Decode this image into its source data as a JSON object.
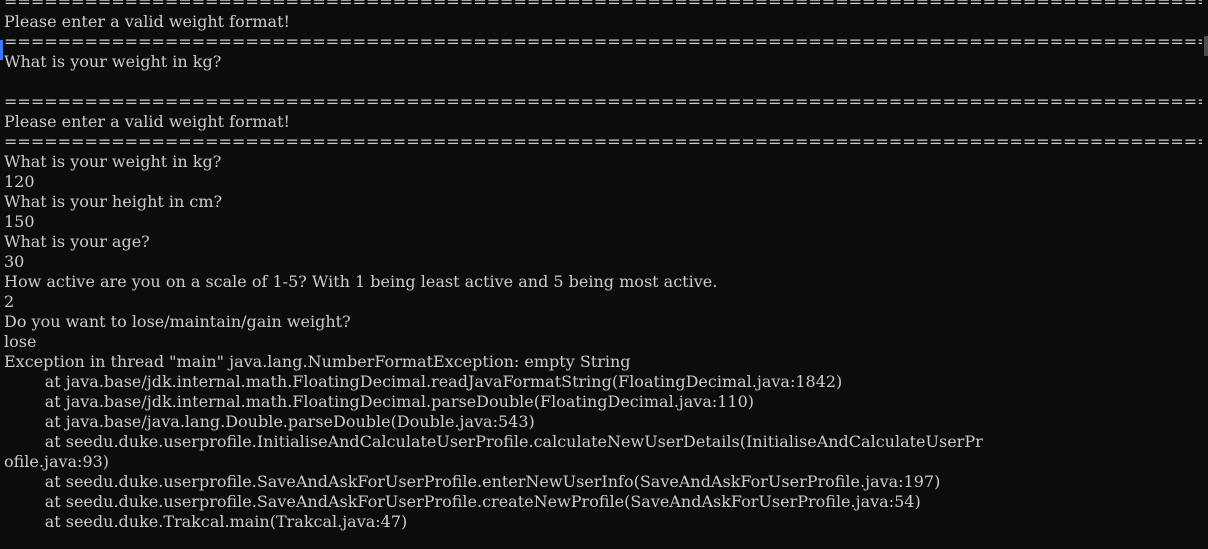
{
  "terminal": {
    "lines": [
      "==========================================================================================================",
      "Please enter a valid weight format!",
      "==========================================================================================================",
      "What is your weight in kg?",
      "",
      "==========================================================================================================",
      "Please enter a valid weight format!",
      "==========================================================================================================",
      "What is your weight in kg?",
      "120",
      "What is your height in cm?",
      "150",
      "What is your age?",
      "30",
      "How active are you on a scale of 1-5? With 1 being least active and 5 being most active.",
      "2",
      "Do you want to lose/maintain/gain weight?",
      "lose",
      "Exception in thread \"main\" java.lang.NumberFormatException: empty String",
      "        at java.base/jdk.internal.math.FloatingDecimal.readJavaFormatString(FloatingDecimal.java:1842)",
      "        at java.base/jdk.internal.math.FloatingDecimal.parseDouble(FloatingDecimal.java:110)",
      "        at java.base/java.lang.Double.parseDouble(Double.java:543)",
      "        at seedu.duke.userprofile.InitialiseAndCalculateUserProfile.calculateNewUserDetails(InitialiseAndCalculateUserPr",
      "ofile.java:93)",
      "        at seedu.duke.userprofile.SaveAndAskForUserProfile.enterNewUserInfo(SaveAndAskForUserProfile.java:197)",
      "        at seedu.duke.userprofile.SaveAndAskForUserProfile.createNewProfile(SaveAndAskForUserProfile.java:54)",
      "        at seedu.duke.Trakcal.main(Trakcal.java:47)"
    ]
  },
  "colors": {
    "background": "#0c0c0c",
    "foreground": "#cccccc",
    "selection_marker": "#3b78ff"
  }
}
